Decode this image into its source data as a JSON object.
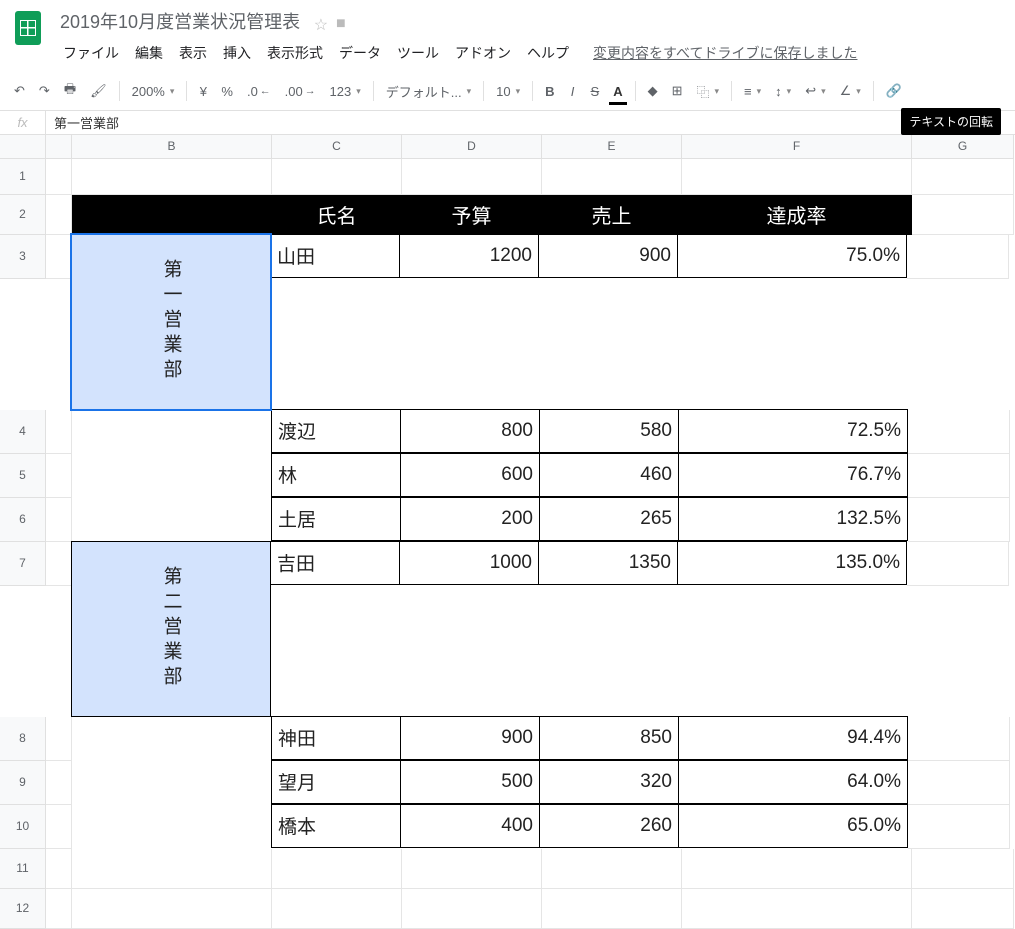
{
  "doc": {
    "title": "2019年10月度営業状況管理表"
  },
  "menu": {
    "file": "ファイル",
    "edit": "編集",
    "view": "表示",
    "insert": "挿入",
    "format": "表示形式",
    "data": "データ",
    "tools": "ツール",
    "addons": "アドオン",
    "help": "ヘルプ"
  },
  "save_msg": "変更内容をすべてドライブに保存しました",
  "toolbar": {
    "zoom": "200%",
    "currency": "¥",
    "percent": "%",
    "dec_dec": ".0",
    "dec_inc": ".00",
    "more_fmt": "123",
    "font": "デフォルト...",
    "fontsize": "10"
  },
  "tooltip": "テキストの回転",
  "fx": {
    "label": "fx",
    "value": "第一営業部"
  },
  "cols": {
    "A": "",
    "B": "B",
    "C": "C",
    "D": "D",
    "E": "E",
    "F": "F",
    "G": "G"
  },
  "rownums": [
    "1",
    "2",
    "3",
    "4",
    "5",
    "6",
    "7",
    "8",
    "9",
    "10",
    "11",
    "12"
  ],
  "table": {
    "headers": {
      "name": "氏名",
      "budget": "予算",
      "sales": "売上",
      "rate": "達成率"
    },
    "group1": "第一営業部",
    "group2": "第二営業部",
    "rows": [
      {
        "name": "山田",
        "budget": "1200",
        "sales": "900",
        "rate": "75.0%"
      },
      {
        "name": "渡辺",
        "budget": "800",
        "sales": "580",
        "rate": "72.5%"
      },
      {
        "name": "林",
        "budget": "600",
        "sales": "460",
        "rate": "76.7%"
      },
      {
        "name": "土居",
        "budget": "200",
        "sales": "265",
        "rate": "132.5%"
      },
      {
        "name": "吉田",
        "budget": "1000",
        "sales": "1350",
        "rate": "135.0%"
      },
      {
        "name": "神田",
        "budget": "900",
        "sales": "850",
        "rate": "94.4%"
      },
      {
        "name": "望月",
        "budget": "500",
        "sales": "320",
        "rate": "64.0%"
      },
      {
        "name": "橋本",
        "budget": "400",
        "sales": "260",
        "rate": "65.0%"
      }
    ]
  }
}
